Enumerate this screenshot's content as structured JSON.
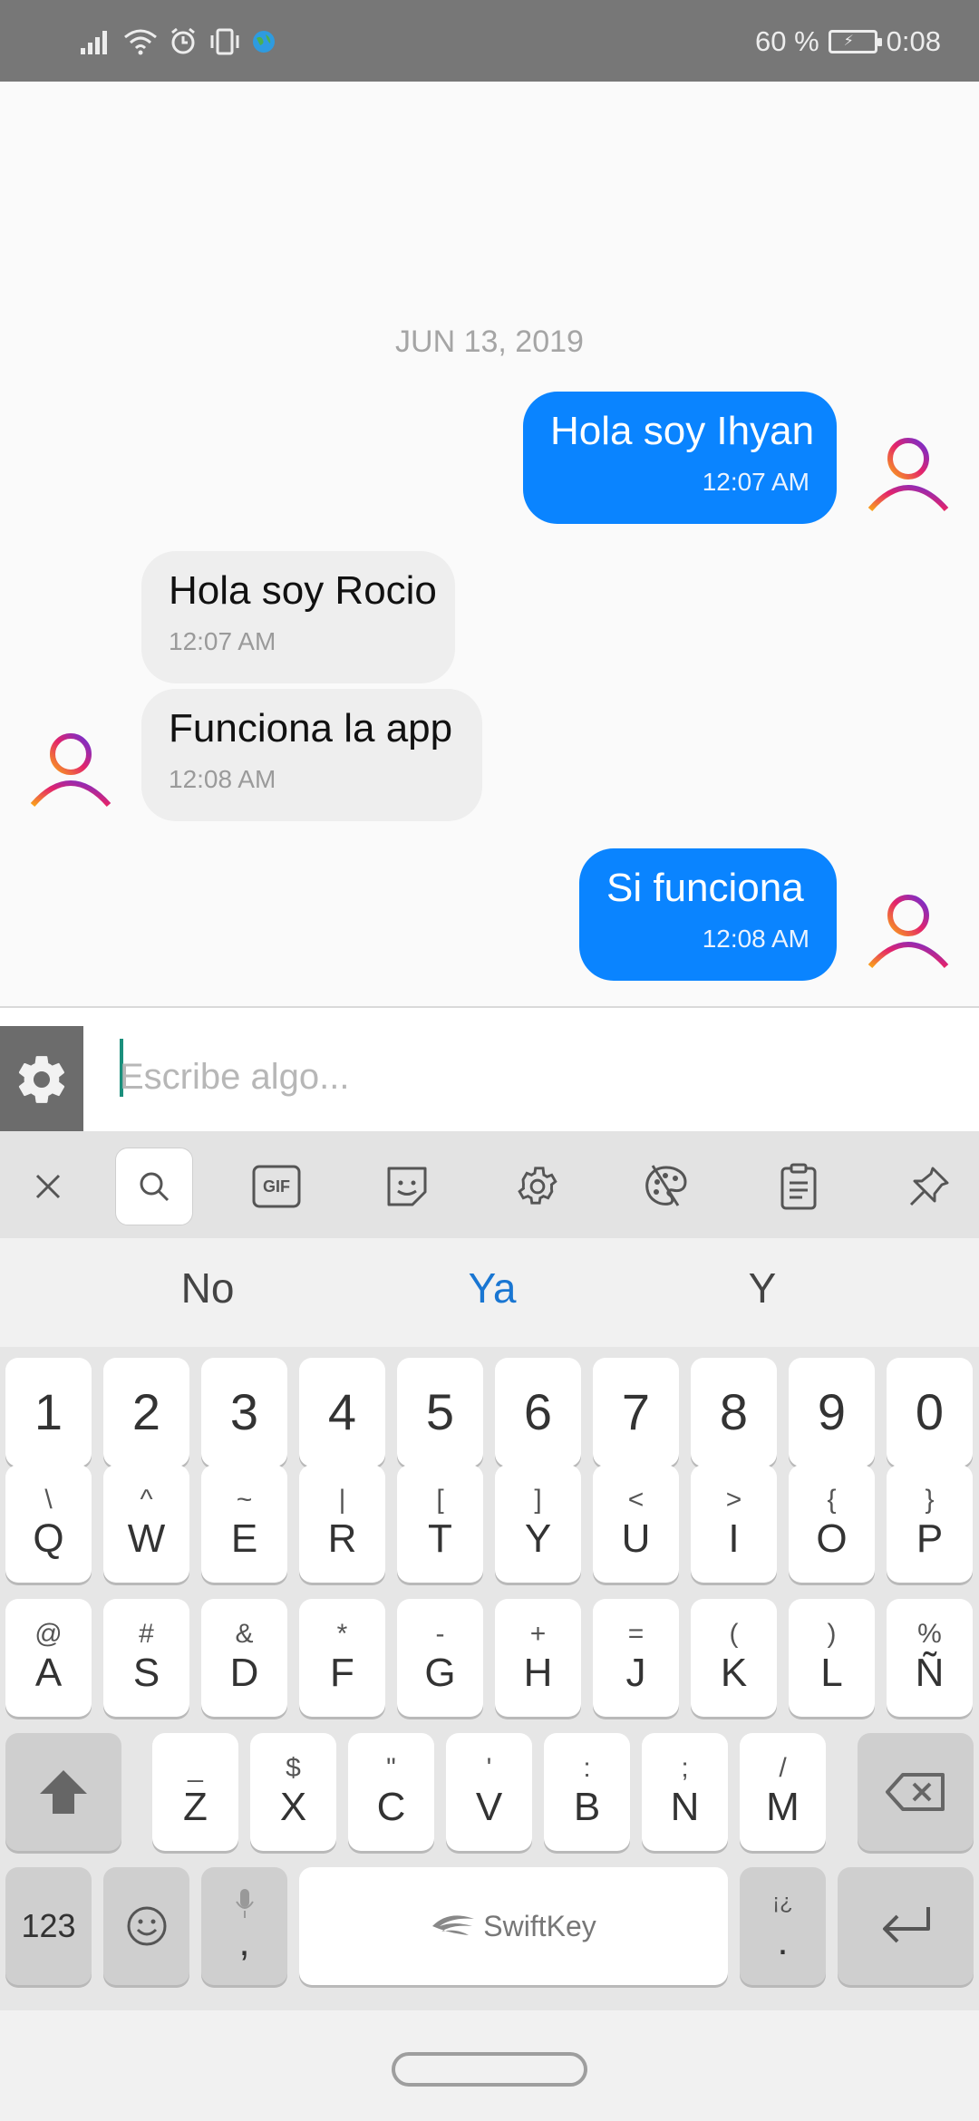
{
  "status_bar": {
    "battery": "60 %",
    "time": "0:08",
    "icons": [
      "signal-icon",
      "wifi-icon",
      "alarm-icon",
      "vibrate-icon",
      "vpn-globe-icon",
      "battery-icon"
    ]
  },
  "chat": {
    "date": "JUN 13, 2019",
    "messages": [
      {
        "side": "out",
        "text": "Hola soy Ihyan",
        "time": "12:07 AM"
      },
      {
        "side": "in",
        "text": "Hola soy Rocio",
        "time": "12:07 AM"
      },
      {
        "side": "in",
        "text": "Funciona la app",
        "time": "12:08 AM"
      },
      {
        "side": "out",
        "text": "Si funciona",
        "time": "12:08 AM"
      }
    ]
  },
  "input": {
    "placeholder": "Escribe algo...",
    "settings_icon": "gear-icon"
  },
  "keyboard": {
    "toolbar_icons": [
      "close-icon",
      "search-icon",
      "gif-icon",
      "sticker-icon",
      "settings-icon",
      "theme-palette-icon",
      "clipboard-icon",
      "pin-icon"
    ],
    "toolbar_gif_text": "GIF",
    "suggestions": [
      "No",
      "Ya",
      "Y"
    ],
    "number_row": [
      "1",
      "2",
      "3",
      "4",
      "5",
      "6",
      "7",
      "8",
      "9",
      "0"
    ],
    "row1": [
      {
        "sub": "\\",
        "main": "Q"
      },
      {
        "sub": "^",
        "main": "W"
      },
      {
        "sub": "~",
        "main": "E"
      },
      {
        "sub": "|",
        "main": "R"
      },
      {
        "sub": "[",
        "main": "T"
      },
      {
        "sub": "]",
        "main": "Y"
      },
      {
        "sub": "<",
        "main": "U"
      },
      {
        "sub": ">",
        "main": "I"
      },
      {
        "sub": "{",
        "main": "O"
      },
      {
        "sub": "}",
        "main": "P"
      }
    ],
    "row2": [
      {
        "sub": "@",
        "main": "A"
      },
      {
        "sub": "#",
        "main": "S"
      },
      {
        "sub": "&",
        "main": "D"
      },
      {
        "sub": "*",
        "main": "F"
      },
      {
        "sub": "-",
        "main": "G"
      },
      {
        "sub": "+",
        "main": "H"
      },
      {
        "sub": "=",
        "main": "J"
      },
      {
        "sub": "(",
        "main": "K"
      },
      {
        "sub": ")",
        "main": "L"
      },
      {
        "sub": "%",
        "main": "Ñ"
      }
    ],
    "row3": [
      {
        "sub": "_",
        "main": "Z"
      },
      {
        "sub": "$",
        "main": "X"
      },
      {
        "sub": "\"",
        "main": "C"
      },
      {
        "sub": "'",
        "main": "V"
      },
      {
        "sub": ":",
        "main": "B"
      },
      {
        "sub": ";",
        "main": "N"
      },
      {
        "sub": "/",
        "main": "M"
      }
    ],
    "bottom": {
      "numbers_label": "123",
      "comma_label": ",",
      "space_label": "SwiftKey",
      "period_sub": "¡¿",
      "period_label": "."
    }
  },
  "colors": {
    "outgoing_bubble": "#0a84ff",
    "incoming_bubble": "#eeeeee",
    "accent": "#1976d2"
  }
}
